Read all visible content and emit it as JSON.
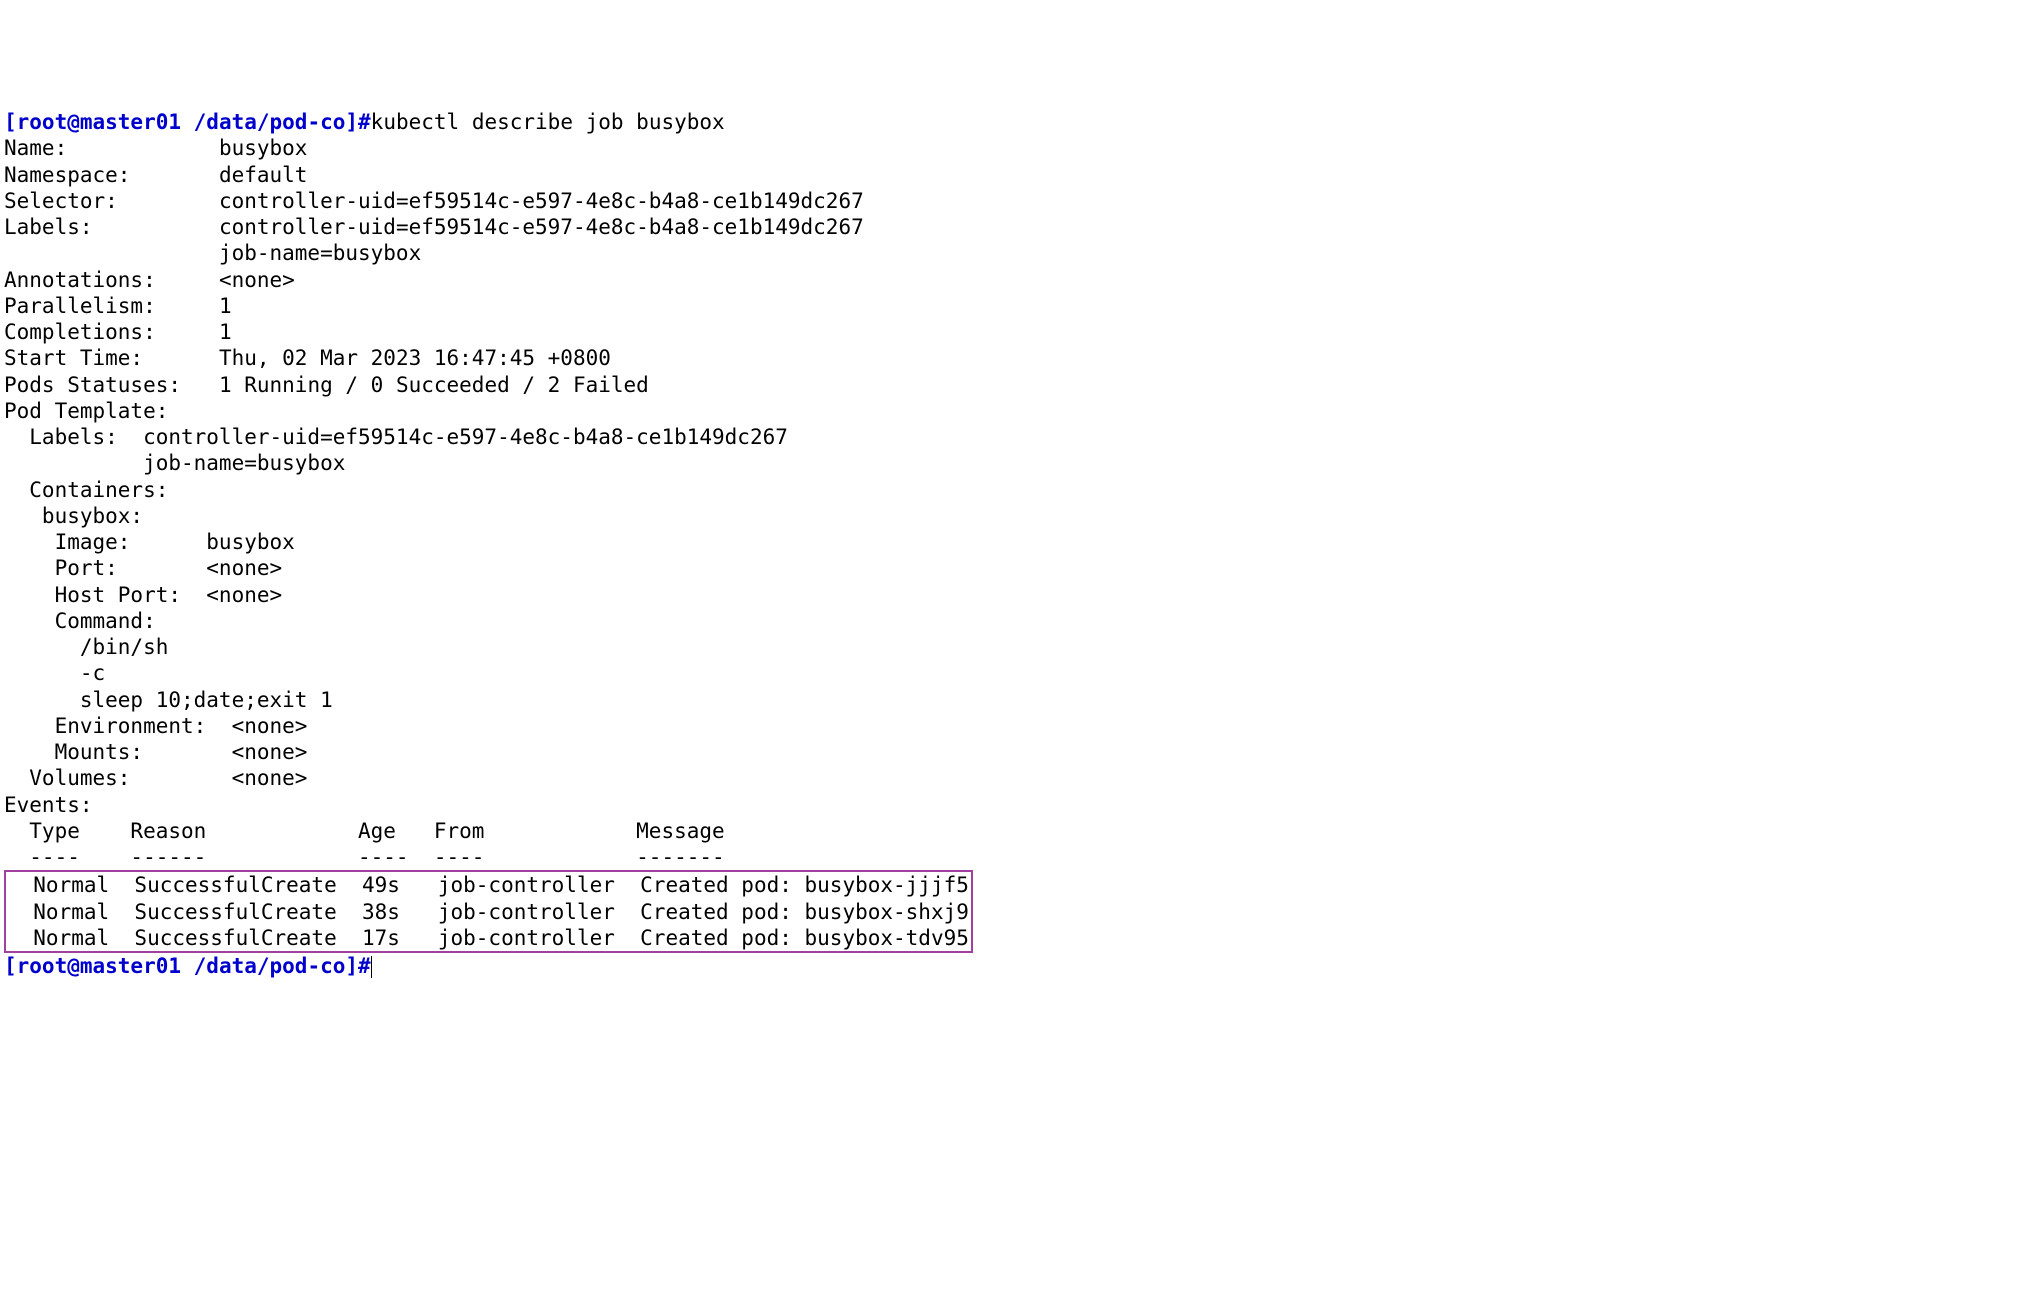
{
  "line1": {
    "prompt_open": "[root@master01 ",
    "prompt_path": "/data/pod-co",
    "prompt_close": "]#",
    "command": "kubectl describe job busybox"
  },
  "describe": {
    "name_key": "Name:            ",
    "name_val": "busybox",
    "ns_key": "Namespace:       ",
    "ns_val": "default",
    "sel_key": "Selector:        ",
    "sel_val": "controller-uid=ef59514c-e597-4e8c-b4a8-ce1b149dc267",
    "lab_key": "Labels:          ",
    "lab_val1": "controller-uid=ef59514c-e597-4e8c-b4a8-ce1b149dc267",
    "lab_val2": "                 job-name=busybox",
    "ann_key": "Annotations:     ",
    "ann_val": "<none>",
    "par_key": "Parallelism:     ",
    "par_val": "1",
    "comp_key": "Completions:     ",
    "comp_val": "1",
    "st_key": "Start Time:      ",
    "st_val": "Thu, 02 Mar 2023 16:47:45 +0800",
    "ps_key": "Pods Statuses:   ",
    "ps_val": "1 Running / 0 Succeeded / 2 Failed",
    "pt_key": "Pod Template:",
    "pt_labels": "  Labels:  controller-uid=ef59514c-e597-4e8c-b4a8-ce1b149dc267",
    "pt_labels2": "           job-name=busybox",
    "pt_containers": "  Containers:",
    "pt_cname": "   busybox:",
    "pt_image": "    Image:      busybox",
    "pt_port": "    Port:       <none>",
    "pt_hostport": "    Host Port:  <none>",
    "pt_command": "    Command:",
    "pt_cmd1": "      /bin/sh",
    "pt_cmd2": "      -c",
    "pt_cmd3": "      sleep 10;date;exit 1",
    "pt_env": "    Environment:  <none>",
    "pt_mounts": "    Mounts:       <none>",
    "pt_volumes": "  Volumes:        <none>",
    "events_key": "Events:",
    "events_header": "  Type    Reason            Age   From            Message",
    "events_divider": "  ----    ------            ----  ----            -------"
  },
  "events": {
    "row1": "  Normal  SuccessfulCreate  49s   job-controller  Created pod: busybox-jjjf5",
    "row2": "  Normal  SuccessfulCreate  38s   job-controller  Created pod: busybox-shxj9",
    "row3": "  Normal  SuccessfulCreate  17s   job-controller  Created pod: busybox-tdv95"
  },
  "line_last": {
    "prompt_open": "[root@master01 ",
    "prompt_path": "/data/pod-co",
    "prompt_close": "]#"
  }
}
